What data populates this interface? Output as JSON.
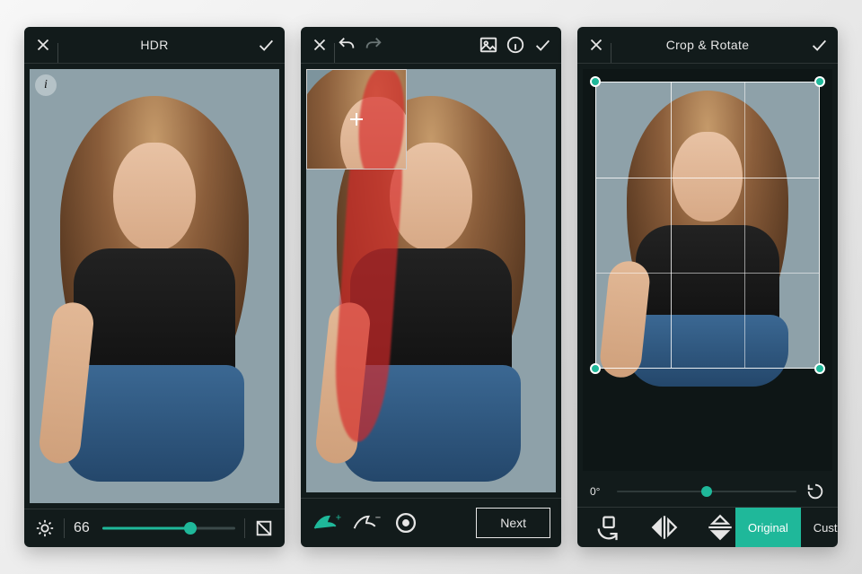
{
  "accent": "#1fb89a",
  "screen1": {
    "title": "HDR",
    "brightness_value": "66",
    "brightness_pct": 66
  },
  "screen2": {
    "next_label": "Next"
  },
  "screen3": {
    "title": "Crop & Rotate",
    "angle_label": "0°",
    "angle_pct": 50,
    "aspect_original": "Original",
    "aspect_custom": "Custom"
  }
}
